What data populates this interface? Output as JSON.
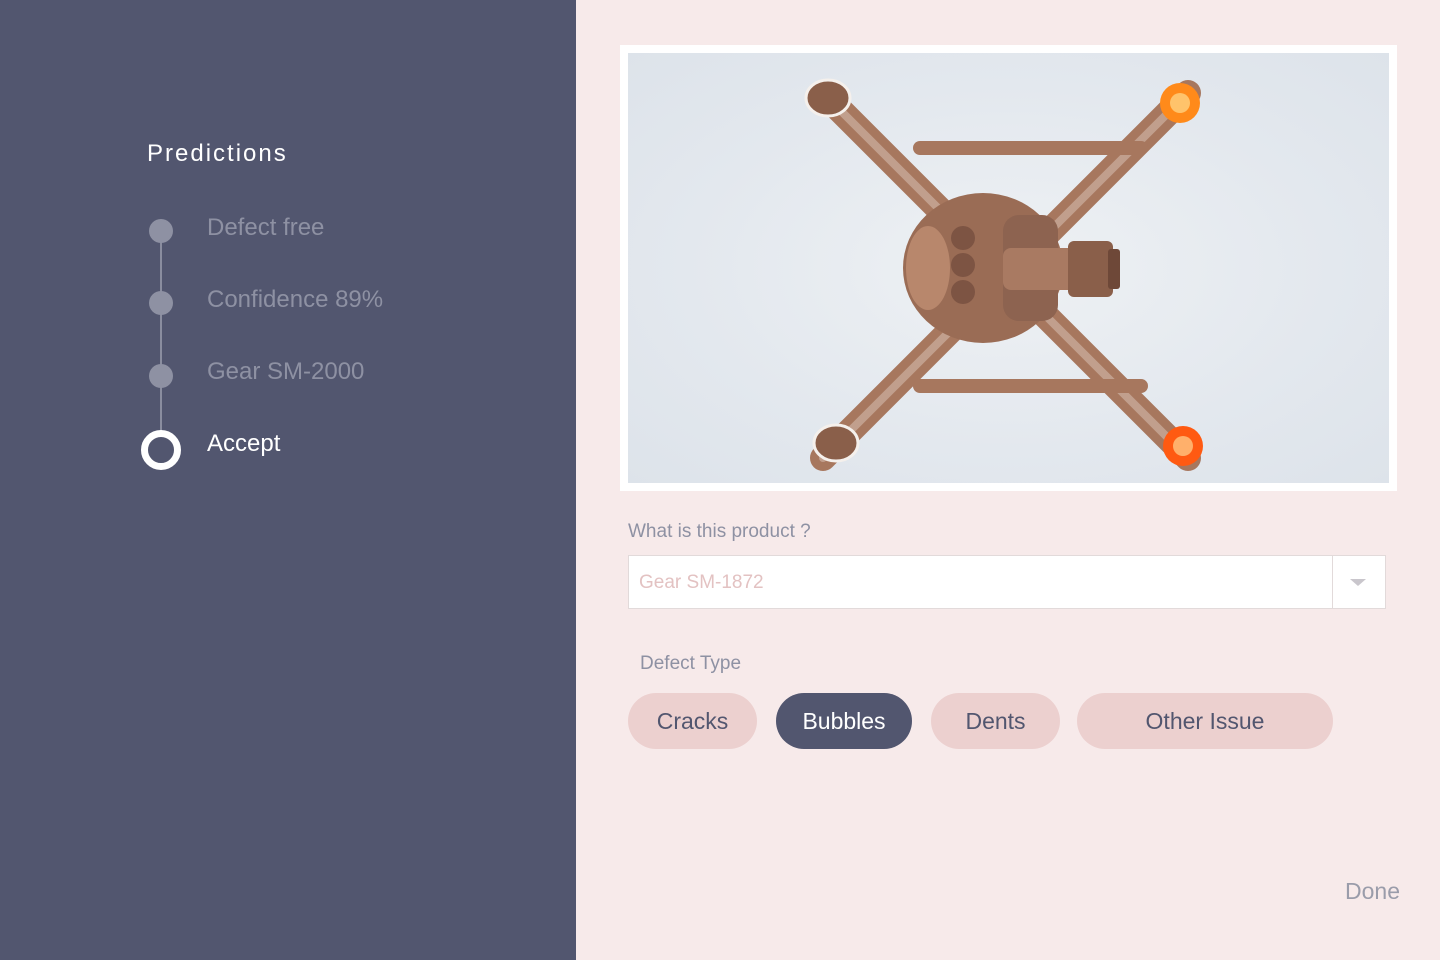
{
  "sidebar": {
    "title": "Predictions",
    "steps": [
      {
        "label": "Defect free",
        "active": false
      },
      {
        "label": "Confidence 89%",
        "active": false
      },
      {
        "label": "Gear SM-2000",
        "active": false
      },
      {
        "label": "Accept",
        "active": true
      }
    ]
  },
  "main": {
    "question_label": "What is this product ?",
    "product_select": {
      "value": "Gear SM-1872"
    },
    "defect_type_label": "Defect Type",
    "defect_types": [
      {
        "label": "Cracks",
        "selected": false
      },
      {
        "label": "Bubbles",
        "selected": true
      },
      {
        "label": "Dents",
        "selected": false
      },
      {
        "label": "Other Issue",
        "selected": false
      }
    ],
    "done_label": "Done"
  },
  "colors": {
    "sidebar_bg": "#52566f",
    "main_bg": "#f7eaea",
    "chip_bg": "#ecd0cf",
    "chip_selected_bg": "#52566f"
  }
}
